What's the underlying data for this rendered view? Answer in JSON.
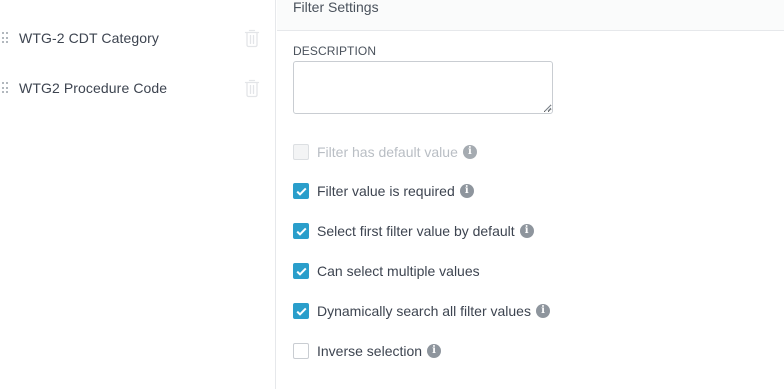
{
  "filters_list": {
    "items": [
      {
        "label": "WTG-2 CDT Category",
        "drag_icon": "drag-handle-icon",
        "delete_icon": "trash-icon"
      },
      {
        "label": "WTG2 Procedure Code",
        "drag_icon": "drag-handle-icon",
        "delete_icon": "trash-icon"
      }
    ]
  },
  "settings": {
    "title": "Filter Settings",
    "description": {
      "label": "DESCRIPTION",
      "value": "",
      "placeholder": ""
    },
    "options": [
      {
        "label": "Filter has default value",
        "checked": false,
        "disabled": true,
        "info": true
      },
      {
        "label": "Filter value is required",
        "checked": true,
        "disabled": false,
        "info": true
      },
      {
        "label": "Select first filter value by default",
        "checked": true,
        "disabled": false,
        "info": true
      },
      {
        "label": "Can select multiple values",
        "checked": true,
        "disabled": false,
        "info": false
      },
      {
        "label": "Dynamically search all filter values",
        "checked": true,
        "disabled": false,
        "info": true
      },
      {
        "label": "Inverse selection",
        "checked": false,
        "disabled": false,
        "info": true
      }
    ],
    "info_glyph": "i"
  },
  "colors": {
    "accent": "#2a9ecb",
    "text": "#3d4450",
    "border": "#e6e8eb",
    "info_icon": "#8e959d",
    "disabled_text": "#b9bec4"
  }
}
